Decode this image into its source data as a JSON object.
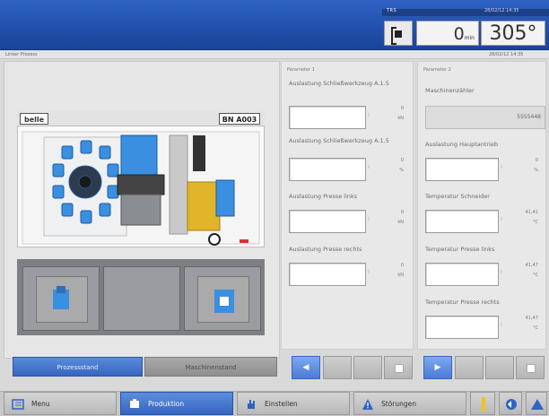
{
  "header": {
    "status_label": "TRS",
    "status_label_right": "28/02/12 14:35",
    "counter_value": "0",
    "counter_unit": "min",
    "temperature": "305°"
  },
  "substrip": {
    "left": "Linker Prozess",
    "right": "28/02/12 14:35"
  },
  "machine": {
    "brand": "belle",
    "model": "BN A003"
  },
  "left_tabs": {
    "active": "Prozessstand",
    "inactive": "Maschinenstand"
  },
  "panel_a": {
    "title": "Parameter 1",
    "params": [
      {
        "label": "Auslastung Schließwerkzeug A.1.5",
        "value": "0",
        "unit": "kN"
      },
      {
        "label": "Auslastung Schließwerkzeug A.1.5",
        "value": "0",
        "unit": "%"
      },
      {
        "label": "Auslastung Presse links",
        "value": "0",
        "unit": "kN"
      },
      {
        "label": "Auslastung Presse rechts",
        "value": "0",
        "unit": "kN"
      }
    ]
  },
  "panel_b": {
    "title": "Parameter 2",
    "machine_counter_label": "Maschinenzähler",
    "machine_counter_value": "5555448",
    "params": [
      {
        "label": "Auslastung Hauptantrieb",
        "value": "0",
        "unit": "%"
      },
      {
        "label": "Temperatur Schneider",
        "value": "41,41",
        "unit": "°C"
      },
      {
        "label": "Temperatur Presse links",
        "value": "41,47",
        "unit": "°C"
      },
      {
        "label": "Temperatur Presse rechts",
        "value": "41,47",
        "unit": "°C"
      }
    ]
  },
  "bottom_nav": [
    {
      "label": "Menu"
    },
    {
      "label": "Produktion"
    },
    {
      "label": "Einstellen"
    },
    {
      "label": "Störungen"
    }
  ],
  "colors": {
    "accent": "#2f63c4",
    "machine_blue": "#3a8fe0",
    "machine_yellow": "#e0b52a"
  }
}
